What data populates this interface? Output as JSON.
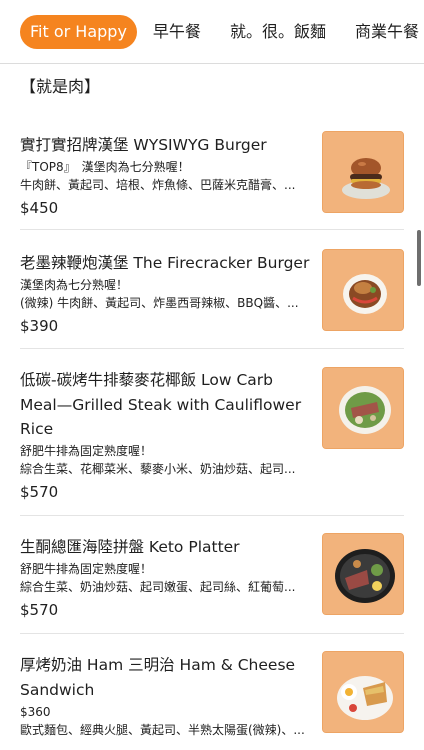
{
  "tabs": [
    {
      "label": "Fit or Happy",
      "active": true
    },
    {
      "label": "早午餐",
      "active": false
    },
    {
      "label": "就。很。飯麵",
      "active": false
    },
    {
      "label": "商業午餐",
      "active": false
    }
  ],
  "section": {
    "title": "【就是肉】"
  },
  "items": [
    {
      "name": "實打實招牌漢堡 WYSIWYG Burger",
      "tag": "『TOP8』　漢堡肉為七分熟喔！",
      "desc": "牛肉餅、黃起司、培根、炸魚條、巴薩米克醋膏、...",
      "price": "$450",
      "image": "burger-image"
    },
    {
      "name": "老墨辣鞭炮漢堡 The Firecracker Burger",
      "tag": "漢堡肉為七分熟喔！",
      "desc": "(微辣) 牛肉餅、黃起司、炸墨西哥辣椒、BBQ醬、...",
      "price": "$390",
      "image": "burger-bowl-image"
    },
    {
      "name": "低碳-碳烤牛排藜麥花椰飯 Low Carb Meal—Grilled Steak with Cauliflower Rice",
      "tag": "舒肥牛排為固定熟度喔！",
      "desc": "綜合生菜、花椰菜米、藜麥小米、奶油炒菇、起司...",
      "price": "$570",
      "image": "steak-bowl-image"
    },
    {
      "name": "生酮總匯海陸拼盤 Keto Platter",
      "tag": "舒肥牛排為固定熟度喔！",
      "desc": "綜合生菜、奶油炒菇、起司嫩蛋、起司絲、紅葡萄...",
      "price": "$570",
      "image": "platter-image"
    },
    {
      "name": "厚烤奶油 Ham 三明治 Ham & Cheese Sandwich",
      "tag": "$360",
      "desc": "歐式麵包、經典火腿、黃起司、半熟太陽蛋(微辣)、...",
      "price": "",
      "image": "sandwich-image"
    }
  ],
  "colors": {
    "accent": "#f5841f",
    "thumb_bg": "#f2b37c"
  }
}
